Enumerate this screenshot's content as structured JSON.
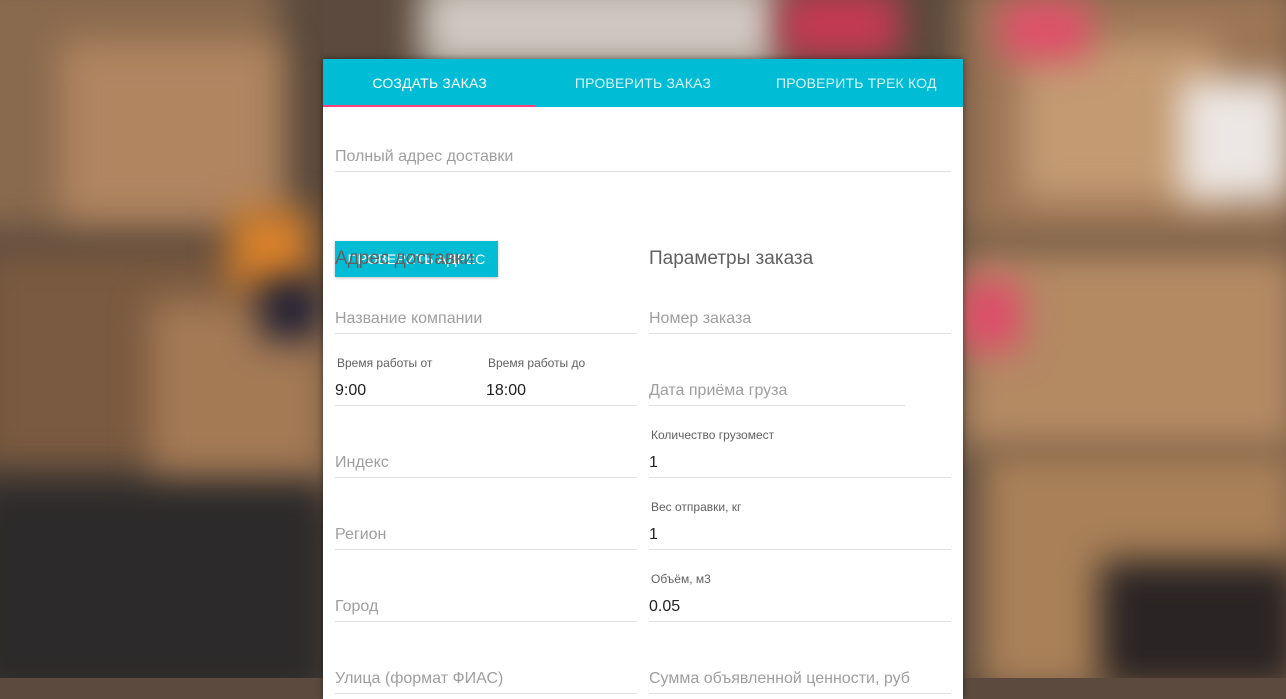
{
  "tabs": [
    {
      "label": "СОЗДАТЬ ЗАКАЗ"
    },
    {
      "label": "ПРОВЕРИТЬ ЗАКАЗ"
    },
    {
      "label": "ПРОВЕРИТЬ ТРЕК КОД"
    }
  ],
  "colors": {
    "accent": "#00bcd4",
    "indicator": "#ff4081"
  },
  "address_search": {
    "placeholder": "Полный адрес доставки",
    "button": "ПРОВЕРИТЬ АДРЕС"
  },
  "delivery": {
    "heading": "Адрес доставки",
    "company_placeholder": "Название компании",
    "work_from_label": "Время работы от",
    "work_from_value": "9:00",
    "work_to_label": "Время работы до",
    "work_to_value": "18:00",
    "index_placeholder": "Индекс",
    "region_placeholder": "Регион",
    "city_placeholder": "Город",
    "street_placeholder": "Улица (формат ФИАС)"
  },
  "order": {
    "heading": "Параметры заказа",
    "number_placeholder": "Номер заказа",
    "date_placeholder": "Дата приёма груза",
    "places_label": "Количество грузомест",
    "places_value": "1",
    "weight_label": "Вес отправки, кг",
    "weight_value": "1",
    "volume_label": "Объём, м3",
    "volume_value": "0.05",
    "declared_value_placeholder": "Сумма объявленной ценности, руб"
  }
}
